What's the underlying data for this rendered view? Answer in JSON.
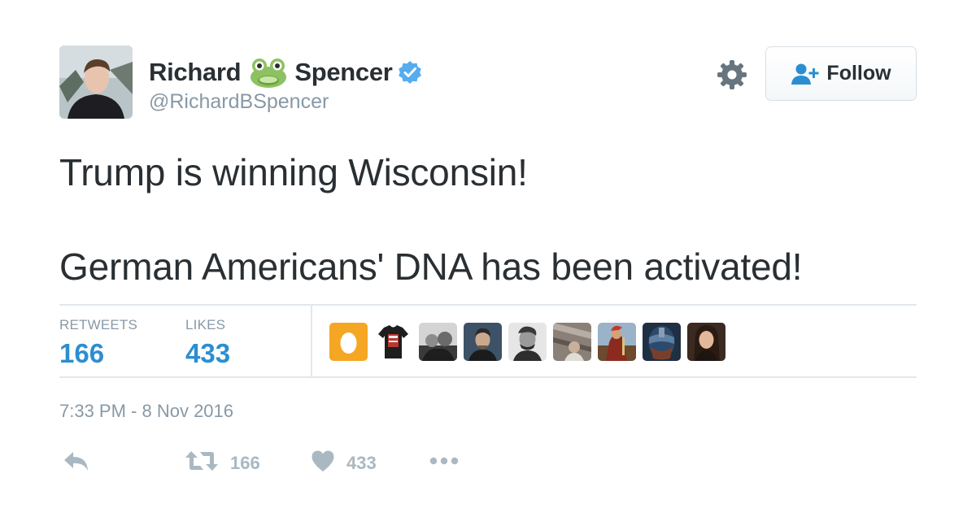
{
  "author": {
    "first_name": "Richard",
    "last_name": "Spencer",
    "handle": "@RichardBSpencer"
  },
  "header": {
    "follow_label": "Follow"
  },
  "tweet": {
    "lines": [
      "Trump is winning Wisconsin!",
      "German Americans' DNA has been activated!"
    ]
  },
  "stats": {
    "retweets_label": "RETWEETS",
    "retweets_value": "166",
    "likes_label": "LIKES",
    "likes_value": "433"
  },
  "likers": [
    {
      "icon": "egg-avatar-icon",
      "color": "#f5a623"
    },
    {
      "icon": "tshirt-avatar-icon",
      "color": "#222222"
    },
    {
      "icon": "photo-avatar-icon",
      "color": "#4a4a4a"
    },
    {
      "icon": "portrait-avatar-icon",
      "color": "#3d5266"
    },
    {
      "icon": "portrait-avatar-icon",
      "color": "#5a5a5a"
    },
    {
      "icon": "photo-avatar-icon",
      "color": "#8a8078"
    },
    {
      "icon": "painting-avatar-icon",
      "color": "#8b5a3c"
    },
    {
      "icon": "face-avatar-icon",
      "color": "#2c4a6b"
    },
    {
      "icon": "portrait-avatar-icon",
      "color": "#3b2a22"
    }
  ],
  "timestamp": "7:33 PM - 8 Nov 2016",
  "actions": {
    "retweet_count": "166",
    "like_count": "433"
  },
  "colors": {
    "accent": "#2b8ed1",
    "verified": "#55acee",
    "muted": "#8899a6",
    "action_icons": "#aab8c2",
    "text": "#292f33"
  }
}
